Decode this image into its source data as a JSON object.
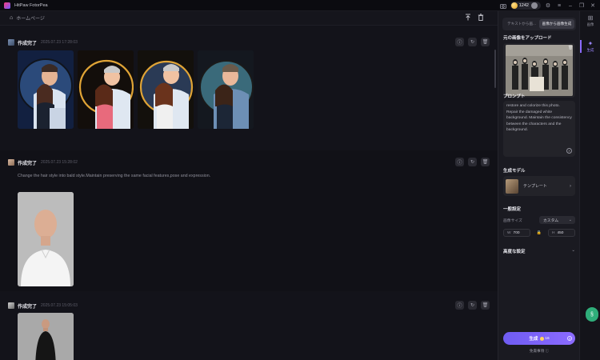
{
  "app": {
    "title": "HitPaw FotorPea",
    "credits": "1242"
  },
  "window_controls": [
    "minimize",
    "restore",
    "close"
  ],
  "topbar": {
    "breadcrumb": "ホームページ"
  },
  "cards": [
    {
      "status": "作成完了",
      "date": "2025.07.23 17:28:03"
    },
    {
      "status": "作成完了",
      "date": "2025.07.23 15:28:02",
      "prompt": "Change the hair style into bald style.Maintain preserving the same facial features,pose and expression."
    },
    {
      "status": "作成完了",
      "date": "2025.07.23 15:05:03"
    }
  ],
  "panel": {
    "tabs": [
      "テキストから画...",
      "画像から画像生成"
    ],
    "active_tab": 1,
    "upload_title": "元の画像をアップロード",
    "prompt_title": "プロンプト",
    "prompt_text": "restore and colorize this photo. Repair the damaged white background. Maintain the consistency between the characters and the background.",
    "model_title": "生成モデル",
    "model_name": "テンプレート",
    "general_title": "一般設定",
    "size_label": "画像サイズ",
    "size_value": "カスタム",
    "width_label": "W",
    "width_value": "700",
    "height_label": "H",
    "height_value": "450",
    "advanced_title": "高度な設定",
    "generate_label": "生成",
    "generate_cost": "16",
    "disclaimer": "免責事項"
  },
  "rail": [
    {
      "label": "画像",
      "icon": "grid-icon"
    },
    {
      "label": "生成",
      "icon": "sparkle-icon"
    }
  ],
  "colors": {
    "accent": "#8b6bff",
    "bg": "#13131a",
    "panel": "#1a1a21"
  }
}
